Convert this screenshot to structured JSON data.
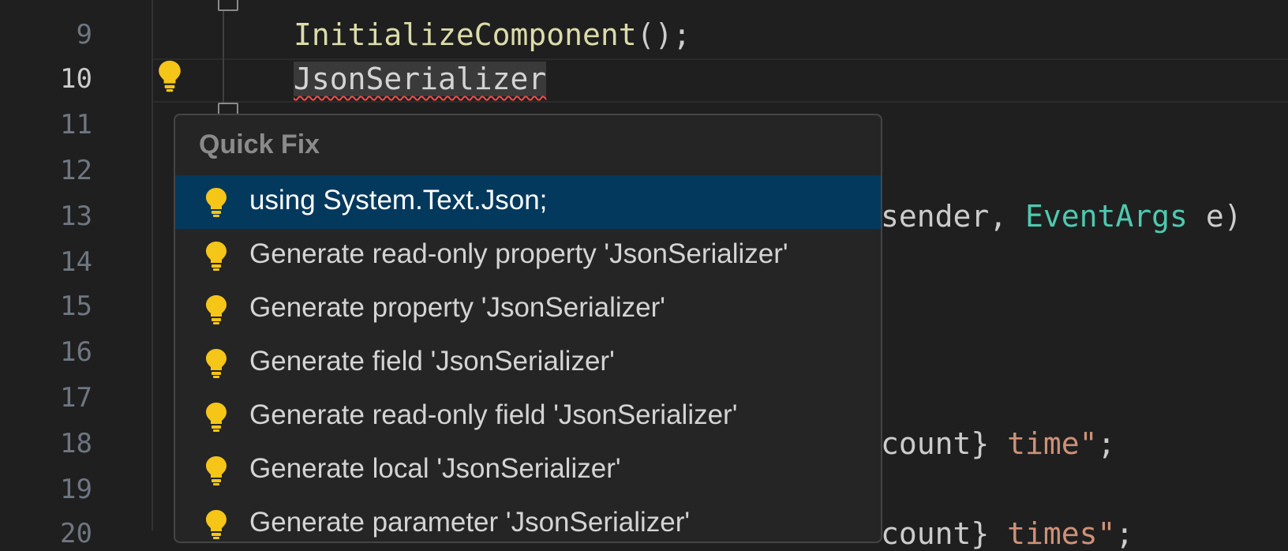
{
  "editor": {
    "line_numbers": [
      "9",
      "10",
      "11",
      "12",
      "13",
      "14",
      "15",
      "16",
      "17",
      "18",
      "19",
      "20"
    ],
    "active_line": "10",
    "lines": {
      "l9_fn": "InitializeComponent",
      "l9_rest": "();",
      "l10_word": "JsonSerializer",
      "l13_a": "sender, ",
      "l13_type": "EventArgs",
      "l13_b": " e)",
      "l18_a": "count} ",
      "l18_str": "time\"",
      "l18_b": ";",
      "l20_a": "count} ",
      "l20_str": "times\"",
      "l20_b": ";"
    }
  },
  "quick_fix": {
    "title": "Quick Fix",
    "items": [
      {
        "label": "using System.Text.Json;",
        "icon": "lightbulb-icon",
        "selected": true
      },
      {
        "label": "Generate read-only property 'JsonSerializer'",
        "icon": "lightbulb-icon"
      },
      {
        "label": "Generate property 'JsonSerializer'",
        "icon": "lightbulb-icon"
      },
      {
        "label": "Generate field 'JsonSerializer'",
        "icon": "lightbulb-icon"
      },
      {
        "label": "Generate read-only field 'JsonSerializer'",
        "icon": "lightbulb-icon"
      },
      {
        "label": "Generate local 'JsonSerializer'",
        "icon": "lightbulb-icon"
      },
      {
        "label": "Generate parameter 'JsonSerializer'",
        "icon": "lightbulb-icon"
      }
    ]
  },
  "colors": {
    "lightbulb": "#f5c518",
    "selection": "#04395e",
    "error_squiggle": "#f14c4c"
  }
}
